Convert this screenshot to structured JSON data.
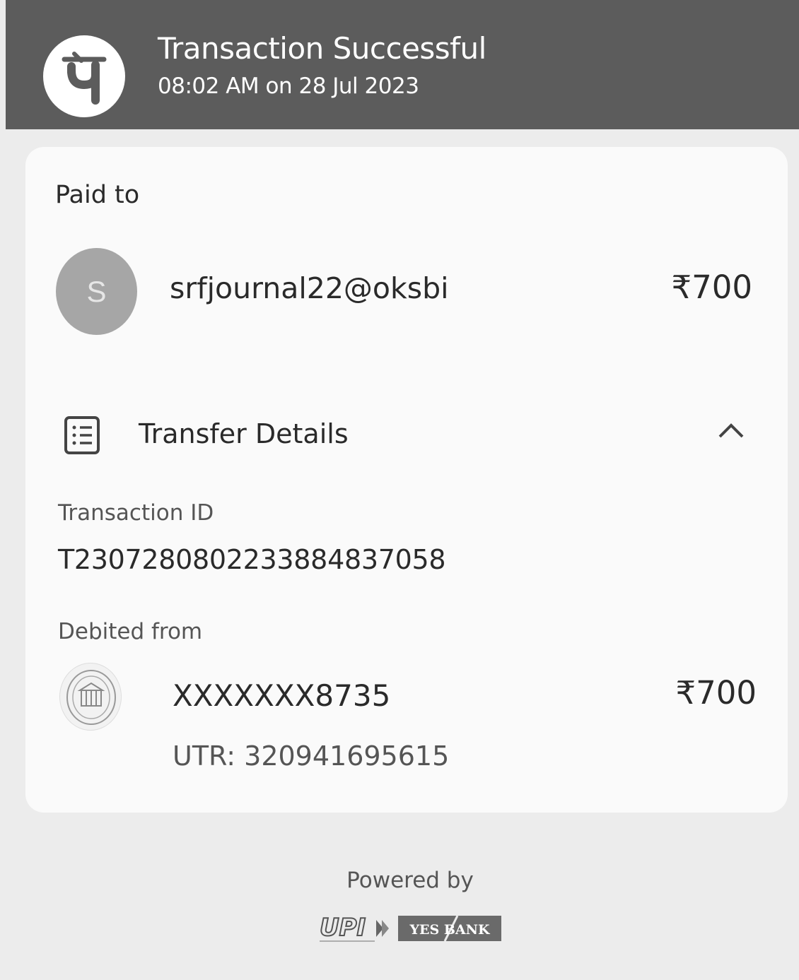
{
  "header": {
    "logo_icon": "phonepe-logo-icon",
    "title": "Transaction Successful",
    "timestamp": "08:02 AM on 28 Jul 2023",
    "background": "#5c5c5c"
  },
  "paid_to": {
    "label": "Paid to",
    "avatar_initial": "S",
    "payee": "srfjournal22@oksbi",
    "amount": "₹700"
  },
  "transfer_details": {
    "icon": "document-list-icon",
    "title": "Transfer Details",
    "toggle_icon": "chevron-up-icon",
    "transaction_id_label": "Transaction ID",
    "transaction_id": "T2307280802233884837058",
    "debited_from_label": "Debited from",
    "bank_icon": "bank-seal-icon",
    "account": "XXXXXXX8735",
    "amount": "₹700",
    "utr": "UTR: 320941695615"
  },
  "footer": {
    "powered_by": "Powered by",
    "upi_logo": "UPI",
    "bank_badge": "YES BANK"
  }
}
